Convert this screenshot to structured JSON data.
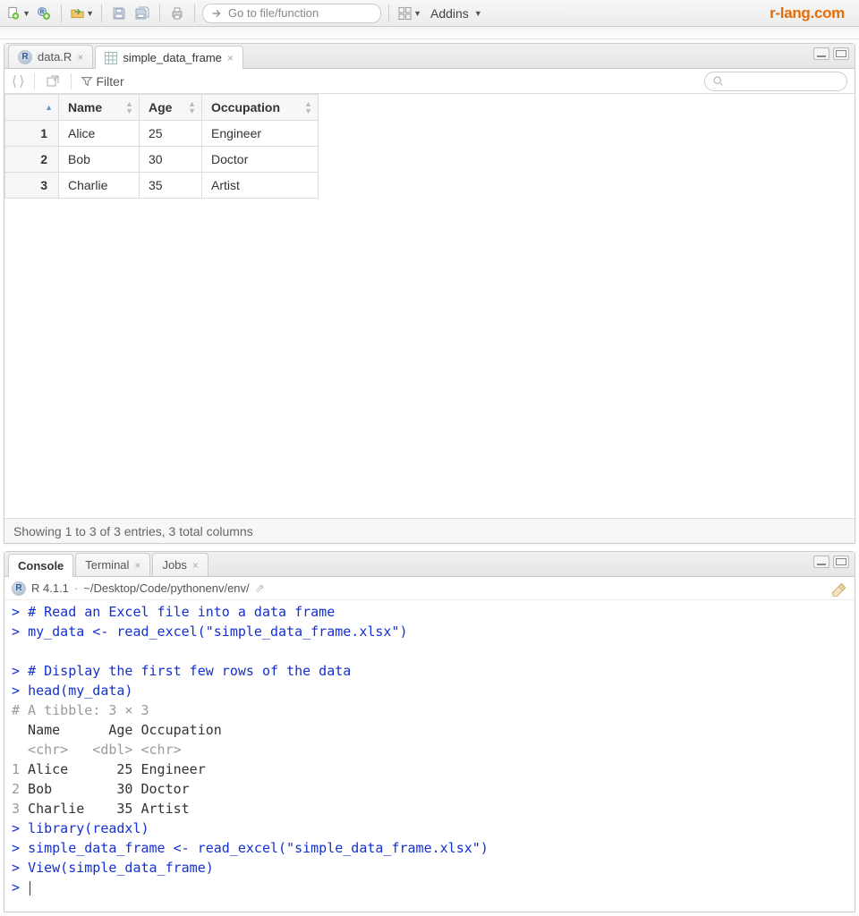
{
  "toolbar": {
    "goto_placeholder": "Go to file/function",
    "addins_label": "Addins"
  },
  "brand": "r-lang.com",
  "tabs": {
    "source": [
      {
        "label": "data.R",
        "icon": "r"
      },
      {
        "label": "simple_data_frame",
        "icon": "grid"
      }
    ],
    "active_source": 1,
    "console": [
      {
        "label": "Console"
      },
      {
        "label": "Terminal"
      },
      {
        "label": "Jobs"
      }
    ],
    "active_console": 0
  },
  "viewer": {
    "filter_label": "Filter",
    "columns": [
      "Name",
      "Age",
      "Occupation"
    ],
    "rows": [
      {
        "n": "1",
        "Name": "Alice",
        "Age": "25",
        "Occupation": "Engineer"
      },
      {
        "n": "2",
        "Name": "Bob",
        "Age": "30",
        "Occupation": "Doctor"
      },
      {
        "n": "3",
        "Name": "Charlie",
        "Age": "35",
        "Occupation": "Artist"
      }
    ],
    "status": "Showing 1 to 3 of 3 entries, 3 total columns"
  },
  "console": {
    "version": "R 4.1.1",
    "path": "~/Desktop/Code/pythonenv/env/",
    "lines": [
      {
        "t": "in",
        "s": "# Read an Excel file into a data frame"
      },
      {
        "t": "in",
        "s": "my_data <- read_excel(\"simple_data_frame.xlsx\")"
      },
      {
        "t": "blank",
        "s": ""
      },
      {
        "t": "in",
        "s": "# Display the first few rows of the data"
      },
      {
        "t": "in",
        "s": "head(my_data)"
      },
      {
        "t": "grey",
        "s": "# A tibble: 3 × 3"
      },
      {
        "t": "out",
        "s": "  Name      Age Occupation"
      },
      {
        "t": "grey",
        "s": "  <chr>   <dbl> <chr>     "
      },
      {
        "t": "row",
        "n": "1",
        "s": " Alice      25 Engineer  "
      },
      {
        "t": "row",
        "n": "2",
        "s": " Bob        30 Doctor    "
      },
      {
        "t": "row",
        "n": "3",
        "s": " Charlie    35 Artist    "
      },
      {
        "t": "in",
        "s": "library(readxl)"
      },
      {
        "t": "in",
        "s": "simple_data_frame <- read_excel(\"simple_data_frame.xlsx\")"
      },
      {
        "t": "in",
        "s": "View(simple_data_frame)"
      },
      {
        "t": "prompt",
        "s": ""
      }
    ]
  }
}
